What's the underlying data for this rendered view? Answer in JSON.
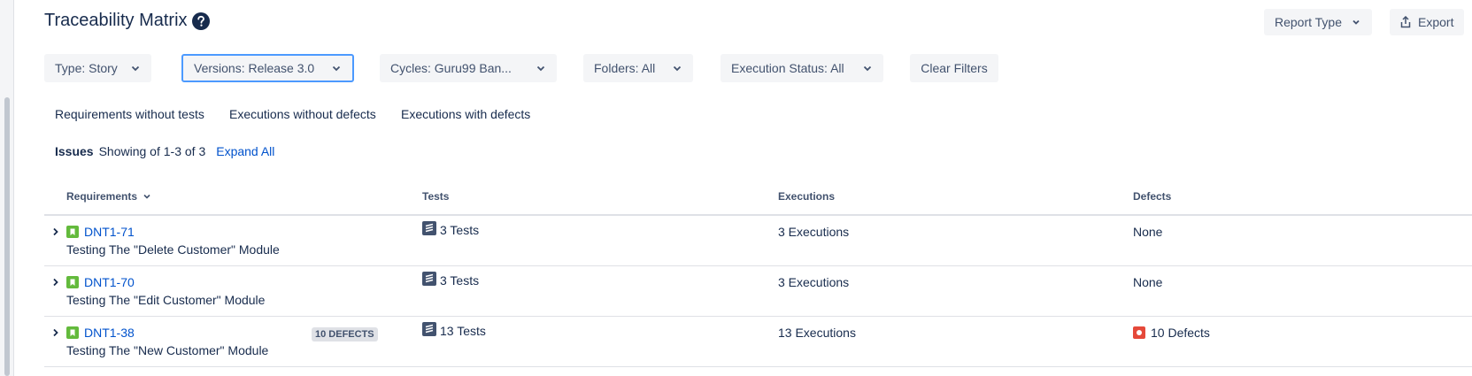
{
  "page": {
    "title": "Traceability Matrix",
    "help_icon": "question-circle-icon"
  },
  "toolbar": {
    "report_type_label": "Report Type",
    "export_label": "Export"
  },
  "filters": [
    {
      "label": "Type: Story"
    },
    {
      "label": "Versions: Release 3.0"
    },
    {
      "label": "Cycles: Guru99 Ban..."
    },
    {
      "label": "Folders: All"
    },
    {
      "label": "Execution Status: All"
    }
  ],
  "clear_filters_label": "Clear Filters",
  "quick_filters": [
    "Requirements without tests",
    "Executions without defects",
    "Executions with defects"
  ],
  "issues_summary": {
    "label": "Issues",
    "text": "Showing of 1-3 of 3",
    "expand_all": "Expand All"
  },
  "table": {
    "headers": {
      "requirements": "Requirements",
      "tests": "Tests",
      "executions": "Executions",
      "defects": "Defects"
    },
    "rows": [
      {
        "key": "DNT1-71",
        "summary": "Testing The \"Delete Customer\" Module",
        "badge": "",
        "tests": "3 Tests",
        "executions": "3 Executions",
        "defects": "None",
        "has_defects": false
      },
      {
        "key": "DNT1-70",
        "summary": "Testing The \"Edit Customer\" Module",
        "badge": "",
        "tests": "3 Tests",
        "executions": "3 Executions",
        "defects": "None",
        "has_defects": false
      },
      {
        "key": "DNT1-38",
        "summary": "Testing The \"New Customer\" Module",
        "badge": "10 DEFECTS",
        "tests": "13 Tests",
        "executions": "13 Executions",
        "defects": "10 Defects",
        "has_defects": true
      }
    ]
  },
  "colors": {
    "link": "#0052cc",
    "story_green": "#63ba3c",
    "bug_red": "#e5493a",
    "focus_border": "#4c9aff"
  }
}
